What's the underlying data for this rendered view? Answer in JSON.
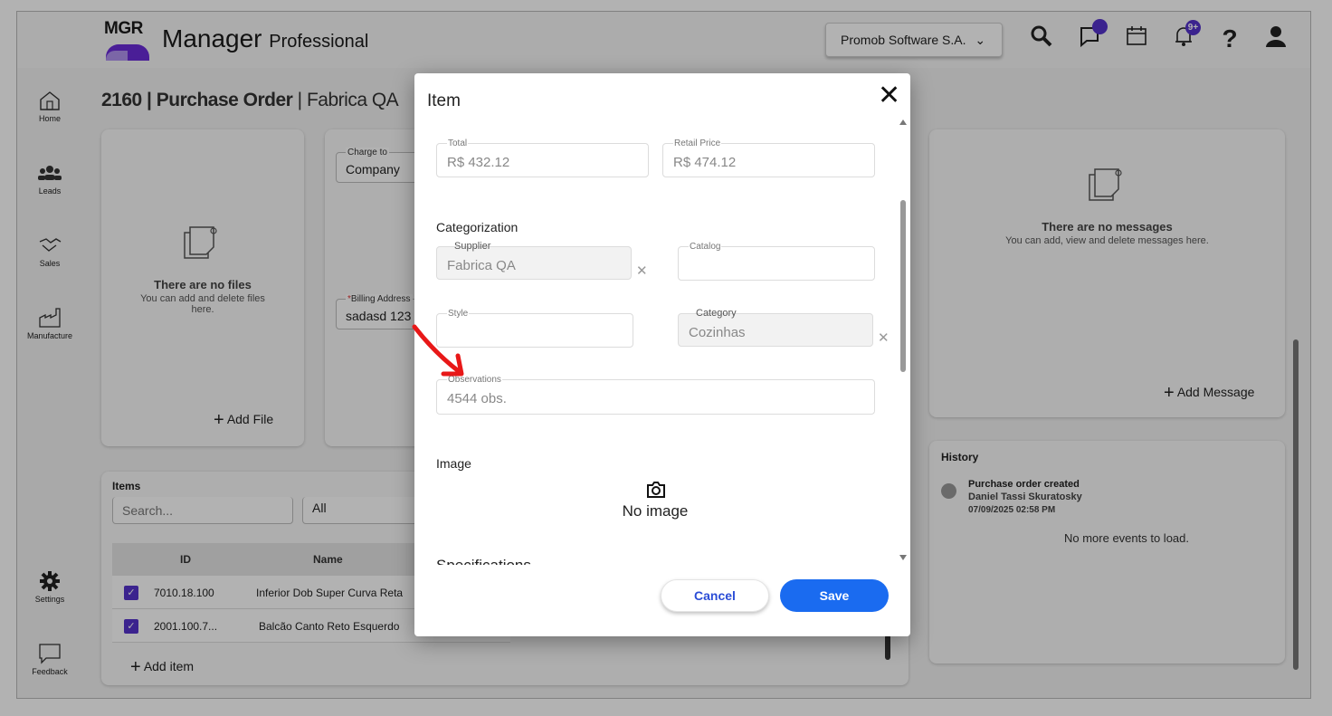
{
  "header": {
    "logo_text": "MGR",
    "brand_main": "Manager",
    "brand_sub": "Professional",
    "company_select": "Promob Software S.A.",
    "icons": [
      "search-icon",
      "chat-icon",
      "calendar-icon",
      "bell-icon",
      "help-icon",
      "user-icon"
    ],
    "notifications_badge": "9+",
    "help_glyph": "?"
  },
  "sidebar": {
    "items": [
      {
        "label": "Home",
        "icon": "home-icon"
      },
      {
        "label": "Leads",
        "icon": "people-icon"
      },
      {
        "label": "Sales",
        "icon": "handshake-icon"
      },
      {
        "label": "Manufacture",
        "icon": "factory-icon"
      },
      {
        "label": "Settings",
        "icon": "gear-icon"
      },
      {
        "label": "Feedback",
        "icon": "feedback-icon"
      }
    ]
  },
  "page": {
    "order_number": "2160",
    "order_type": "Purchase Order",
    "supplier": "Fabrica QA"
  },
  "files_panel": {
    "empty_title": "There are no files",
    "empty_sub": "You can add and delete files here.",
    "add_label": "Add File"
  },
  "billing_panel": {
    "charge_to_label": "Charge to",
    "charge_to_value": "Company",
    "billing_address_label": "Billing Address",
    "billing_address_value": "sadasd 123"
  },
  "messages_panel": {
    "empty_title": "There are no messages",
    "empty_sub": "You can add, view and delete messages here.",
    "add_label": "Add Message"
  },
  "history": {
    "title": "History",
    "event_title": "Purchase order created",
    "event_user": "Daniel Tassi Skuratosky",
    "event_date": "07/09/2025 02:58 PM",
    "no_more": "No more events to load."
  },
  "items_panel": {
    "title": "Items",
    "search_placeholder": "Search...",
    "filter_value": "All",
    "columns": [
      "ID",
      "Name"
    ],
    "rows": [
      {
        "id": "7010.18.100",
        "name": "Inferior Dob Super Curva Reta"
      },
      {
        "id": "2001.100.7...",
        "name": "Balcão Canto Reto Esquerdo"
      }
    ],
    "add_label": "Add item"
  },
  "modal": {
    "title": "Item",
    "total_label": "Total",
    "total_value": "R$ 432.12",
    "retail_label": "Retail Price",
    "retail_value": "R$ 474.12",
    "categorization_title": "Categorization",
    "supplier_label": "Supplier",
    "supplier_value": "Fabrica QA",
    "catalog_label": "Catalog",
    "style_label": "Style",
    "category_label": "Category",
    "category_value": "Cozinhas",
    "observations_label": "Observations",
    "observations_value": "4544 obs.",
    "image_title": "Image",
    "no_image": "No image",
    "specifications_title": "Specifications",
    "cancel_label": "Cancel",
    "save_label": "Save"
  },
  "colors": {
    "accent": "#1a6bf0",
    "brand_purple": "#6a2bd9",
    "checkbox": "#5533cc",
    "annotation_arrow": "#e81818"
  }
}
